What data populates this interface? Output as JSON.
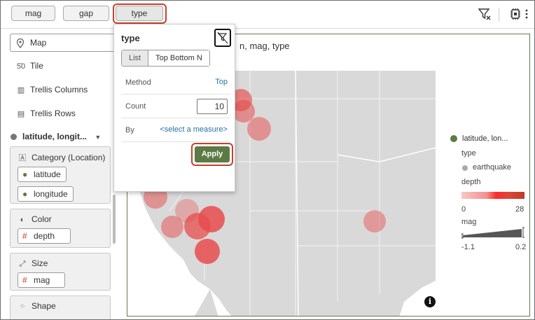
{
  "toolbar": {
    "chips": [
      "mag",
      "gap",
      "type"
    ],
    "selected_chip": "type"
  },
  "left_panel": {
    "viz_type": "Map",
    "items": [
      "Tile",
      "Trellis Columns",
      "Trellis Rows"
    ],
    "layer_label": "latitude, longit...",
    "category_header": "Category (Location)",
    "category_chips": [
      "latitude",
      "longitude"
    ],
    "color_header": "Color",
    "color_chip": "depth",
    "size_header": "Size",
    "size_chip": "mag",
    "shape_header": "Shape"
  },
  "canvas": {
    "title_visible": "n, mag, type"
  },
  "popup": {
    "title": "type",
    "tabs": [
      "List",
      "Top Bottom N"
    ],
    "method_label": "Method",
    "method_value": "Top",
    "count_label": "Count",
    "count_value": "10",
    "by_label": "By",
    "by_value": "<select a measure>",
    "apply_label": "Apply"
  },
  "legend": {
    "layer_name": "latitude, lon...",
    "type_label": "type",
    "type_item": "earthquake",
    "depth_label": "depth",
    "depth_min": "0",
    "depth_max": "28",
    "mag_label": "mag",
    "mag_min": "-1.1",
    "mag_max": "0.2"
  },
  "colors": {
    "accent_green": "#5d7a45",
    "highlight_red": "#c7402d",
    "link_blue": "#2673a8"
  },
  "icons": {
    "filter": "filter-icon",
    "settings": "grid-settings-icon",
    "more": "more-vertical-icon",
    "clear_filter": "filter-clear-icon",
    "info": "info-icon"
  }
}
